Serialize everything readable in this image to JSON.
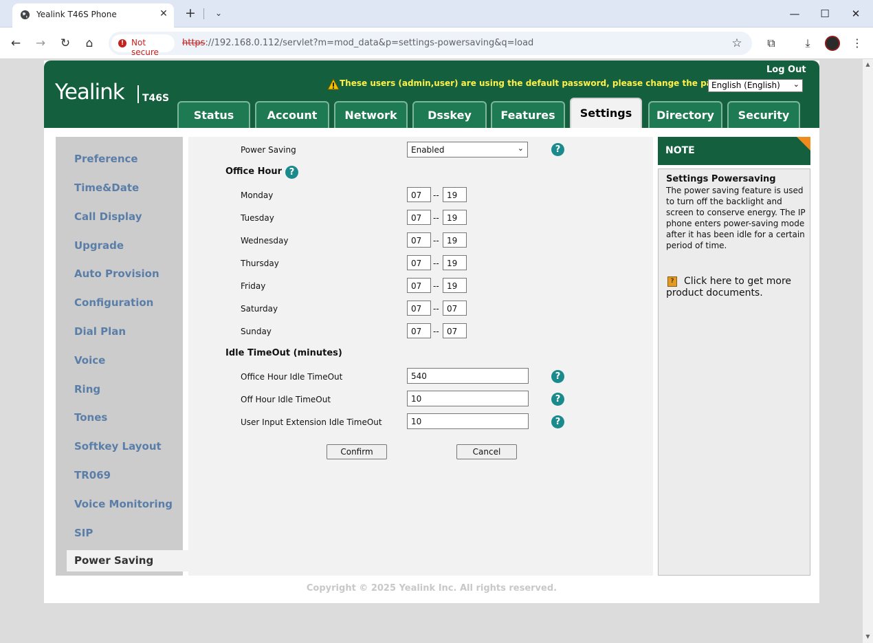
{
  "browser": {
    "tab_title": "Yealink T46S Phone",
    "new_tab": "+",
    "tab_close": "✕",
    "tab_menu": "⌄",
    "security_label": "Not secure",
    "url_scheme": "https",
    "url_rest": "://192.168.0.112/servlet?m=mod_data&p=settings-powersaving&q=load",
    "icons": [
      "globe-icon",
      "close-icon",
      "back-icon",
      "forward-icon",
      "reload-icon",
      "home-icon",
      "star-icon",
      "extensions-icon",
      "download-icon",
      "menu-icon"
    ]
  },
  "header": {
    "logo": "Yealink",
    "model": "T46S",
    "logout": "Log Out",
    "warning": "These users (admin,user) are using the default password, please change the password!",
    "language": "English (English)",
    "tabs": [
      {
        "label": "Status"
      },
      {
        "label": "Account"
      },
      {
        "label": "Network"
      },
      {
        "label": "Dsskey"
      },
      {
        "label": "Features"
      },
      {
        "label": "Settings"
      },
      {
        "label": "Directory"
      },
      {
        "label": "Security"
      }
    ],
    "active_tab": "Settings"
  },
  "sidebar": {
    "items": [
      {
        "label": "Preference"
      },
      {
        "label": "Time&Date"
      },
      {
        "label": "Call Display"
      },
      {
        "label": "Upgrade"
      },
      {
        "label": "Auto Provision"
      },
      {
        "label": "Configuration"
      },
      {
        "label": "Dial Plan"
      },
      {
        "label": "Voice"
      },
      {
        "label": "Ring"
      },
      {
        "label": "Tones"
      },
      {
        "label": "Softkey Layout"
      },
      {
        "label": "TR069"
      },
      {
        "label": "Voice Monitoring"
      },
      {
        "label": "SIP"
      }
    ],
    "active": "Power Saving"
  },
  "form": {
    "power_saving_label": "Power Saving",
    "power_saving_value": "Enabled",
    "office_hour_title": "Office Hour",
    "dash": "--",
    "days": [
      {
        "label": "Monday",
        "start": "07",
        "end": "19"
      },
      {
        "label": "Tuesday",
        "start": "07",
        "end": "19"
      },
      {
        "label": "Wednesday",
        "start": "07",
        "end": "19"
      },
      {
        "label": "Thursday",
        "start": "07",
        "end": "19"
      },
      {
        "label": "Friday",
        "start": "07",
        "end": "19"
      },
      {
        "label": "Saturday",
        "start": "07",
        "end": "07"
      },
      {
        "label": "Sunday",
        "start": "07",
        "end": "07"
      }
    ],
    "idle_title": "Idle TimeOut (minutes)",
    "office_idle_label": "Office Hour Idle TimeOut",
    "office_idle_value": "540",
    "off_idle_label": "Off Hour Idle TimeOut",
    "off_idle_value": "10",
    "input_idle_label": "User Input Extension Idle TimeOut",
    "input_idle_value": "10",
    "confirm": "Confirm",
    "cancel": "Cancel",
    "help": "?"
  },
  "note": {
    "heading": "NOTE",
    "title": "Settings Powersaving",
    "text": "The power saving feature is used to turn off the backlight and screen to conserve energy. The IP phone enters power-saving mode after it has been idle for a certain period of time.",
    "doc_link": "Click here to get more product documents."
  },
  "footer": "Copyright © 2025 Yealink Inc. All rights reserved.",
  "colors": {
    "brand_green": "#135f3e",
    "tab_green": "#1e7a52",
    "warning_yellow": "#fff04a",
    "sidebar_blue": "#5a7ea8",
    "help_teal": "#1a8a8c"
  }
}
